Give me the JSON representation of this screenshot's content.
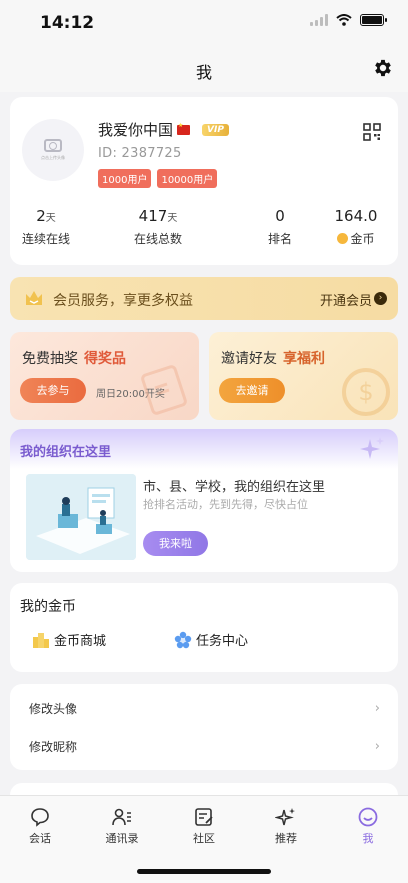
{
  "status_bar": {
    "time": "14:12"
  },
  "header": {
    "title": "我",
    "settings_icon": "gear-icon"
  },
  "profile": {
    "avatar_caption": "点击上传头像",
    "nickname": "我爱你中国",
    "vip_badge": "VIP",
    "user_id": "ID: 2387725",
    "tags": [
      "1000用户",
      "10000用户"
    ],
    "qr_icon": "qr-code-icon",
    "stats": [
      {
        "value": "2",
        "unit": "天",
        "label": "连续在线"
      },
      {
        "value": "417",
        "unit": "天",
        "label": "在线总数"
      },
      {
        "value": "0",
        "unit": "",
        "label": "排名"
      },
      {
        "value": "164.0",
        "unit": "",
        "label": "金币"
      }
    ]
  },
  "vip_banner": {
    "text": "会员服务，享更多权益",
    "action": "开通会员"
  },
  "promos": {
    "lottery": {
      "title": "免费抽奖",
      "highlight": "得奖品",
      "button": "去参与",
      "note": "周日20:00开奖"
    },
    "invite": {
      "title": "邀请好友",
      "highlight": "享福利",
      "button": "去邀请"
    }
  },
  "organization": {
    "title": "我的组织在这里",
    "headline": "市、县、学校，我的组织在这里",
    "subline": "抢排名活动，先到先得，尽快占位",
    "button": "我来啦"
  },
  "coins": {
    "title": "我的金币",
    "items": [
      {
        "label": "金币商城",
        "icon": "building-icon"
      },
      {
        "label": "任务中心",
        "icon": "flower-icon"
      }
    ]
  },
  "menu": {
    "items": [
      {
        "label": "修改头像"
      },
      {
        "label": "修改昵称"
      }
    ]
  },
  "tab_bar": {
    "tabs": [
      {
        "label": "会话",
        "icon": "chat-icon"
      },
      {
        "label": "通讯录",
        "icon": "contacts-icon"
      },
      {
        "label": "社区",
        "icon": "community-icon"
      },
      {
        "label": "推荐",
        "icon": "sparkle-icon"
      },
      {
        "label": "我",
        "icon": "smile-icon"
      }
    ],
    "active": "我",
    "active_color": "#8a6be0"
  }
}
